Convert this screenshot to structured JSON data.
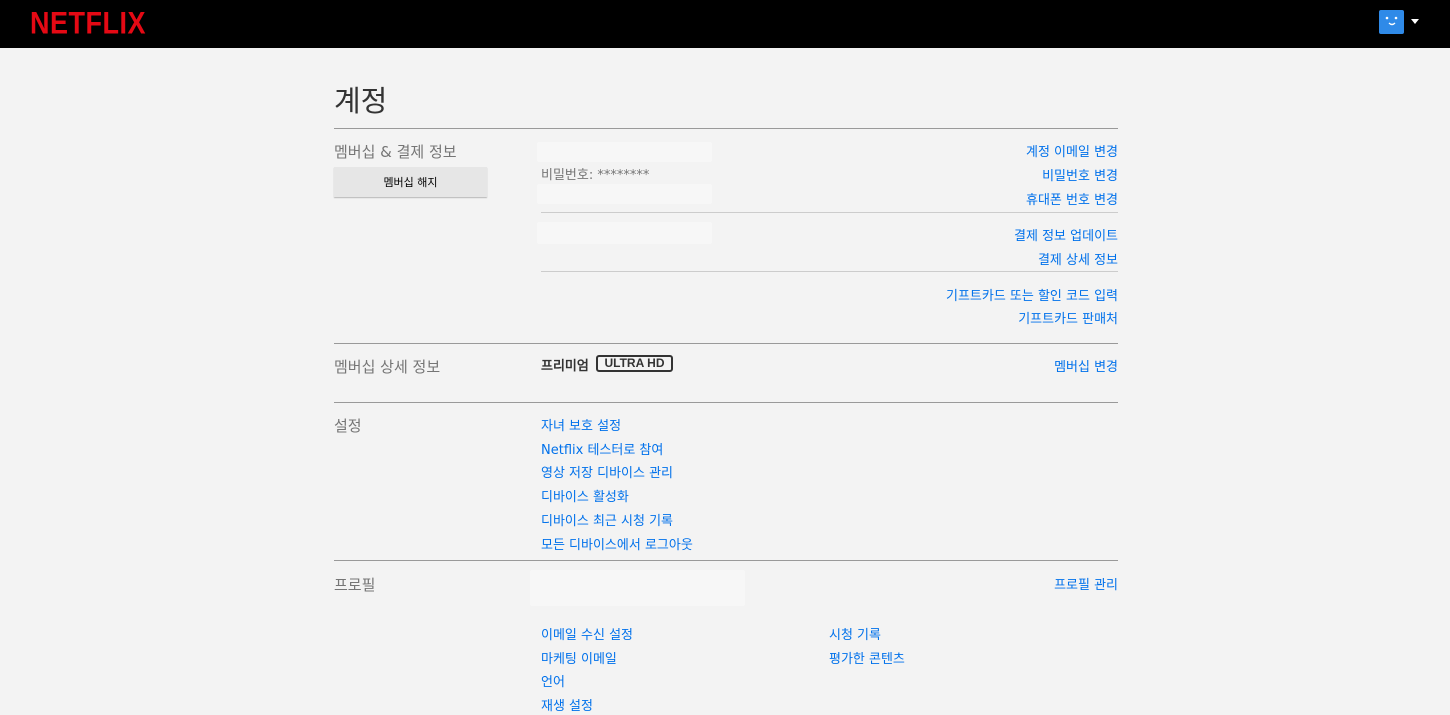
{
  "header": {
    "logo": "NETFLIX"
  },
  "page": {
    "title": "계정"
  },
  "membership": {
    "section_label": "멤버십 & 결제 정보",
    "cancel_button": "멤버십 해지",
    "password_text": "비밀번호: ********",
    "links_account": [
      "계정 이메일 변경",
      "비밀번호 변경",
      "휴대폰 번호 변경"
    ],
    "links_payment": [
      "결제 정보 업데이트",
      "결제 상세 정보"
    ],
    "links_gift": [
      "기프트카드 또는 할인 코드 입력",
      "기프트카드 판매처"
    ]
  },
  "plan": {
    "section_label": "멤버십 상세 정보",
    "plan_name": "프리미엄",
    "plan_badge": "ULTRA HD",
    "change_link": "멤버십 변경"
  },
  "settings": {
    "section_label": "설정",
    "links": [
      "자녀 보호 설정",
      "Netflix 테스터로 참여",
      "영상 저장 디바이스 관리",
      "디바이스 활성화",
      "디바이스 최근 시청 기록",
      "모든 디바이스에서 로그아웃"
    ]
  },
  "profile": {
    "section_label": "프로필",
    "manage_link": "프로필 관리",
    "links_left": [
      "이메일 수신 설정",
      "마케팅 이메일",
      "언어",
      "재생 설정"
    ],
    "links_right": [
      "시청 기록",
      "평가한 콘텐츠"
    ]
  },
  "colors": {
    "brand": "#e50914",
    "link": "#0071eb",
    "avatar": "#2f8ae8"
  },
  "icons": {
    "avatar": "profile-avatar-icon",
    "caret": "caret-down-icon"
  }
}
